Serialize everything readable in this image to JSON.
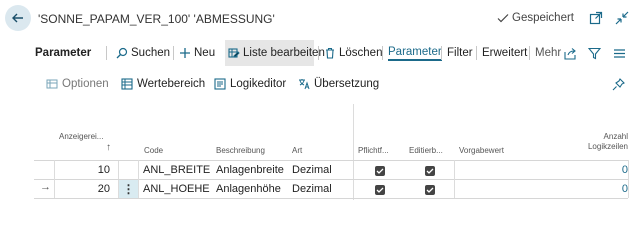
{
  "header": {
    "title": "'SONNE_PAPAM_VER_100' 'ABMESSUNG'",
    "saved_label": "Gespeichert"
  },
  "actions": {
    "section_title": "Parameter",
    "search": "Suchen",
    "new": "Neu",
    "edit_list": "Liste bearbeiten",
    "delete": "Löschen",
    "parameter": "Parameter",
    "filter": "Filter",
    "advanced": "Erweitert",
    "more": "Mehr"
  },
  "toolbar2": {
    "options": "Optionen",
    "value_range": "Wertebereich",
    "logic_editor": "Logikeditor",
    "translation": "Übersetzung"
  },
  "table": {
    "columns": {
      "display_order": "Anzeigerei...",
      "sort_indicator": "↑",
      "code": "Code",
      "description": "Beschreibung",
      "type": "Art",
      "mandatory": "Pflichtf...",
      "editable": "Editierb...",
      "default_value": "Vorgabewert",
      "logic_lines_1": "Anzahl",
      "logic_lines_2": "Logikzeilen"
    },
    "rows": [
      {
        "order": "10",
        "code": "ANL_BREITE",
        "description": "Anlagenbreite",
        "type": "Dezimal",
        "mandatory": true,
        "editable": true,
        "default": "",
        "logic_lines": "0"
      },
      {
        "order": "20",
        "code": "ANL_HOEHE",
        "description": "Anlagenhöhe",
        "type": "Dezimal",
        "mandatory": true,
        "editable": true,
        "default": "",
        "logic_lines": "0"
      }
    ],
    "current_row_marker": "→"
  },
  "colors": {
    "accent": "#1b6a8a",
    "back_button_bg": "#dbe8ef",
    "selected_row_bg": "#d9ebf1"
  }
}
